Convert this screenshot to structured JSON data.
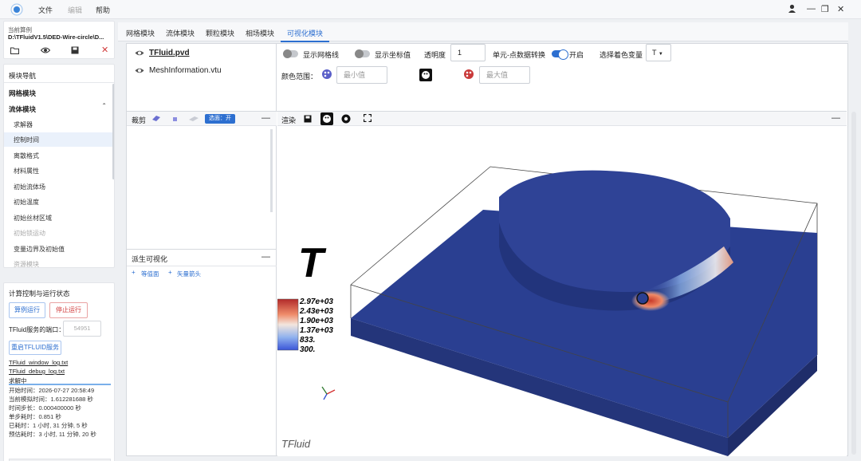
{
  "menu": {
    "file": "文件",
    "edit": "编辑",
    "help": "帮助"
  },
  "case": {
    "label": "当前算例",
    "path": "D:\\TFluidV1.5\\DED-Wire-circle\\D..."
  },
  "nav": {
    "title": "模块导航",
    "grid_module": "网格模块",
    "flow_module": "流体模块",
    "items": [
      "求解器",
      "控制时间",
      "离散格式",
      "材料属性",
      "初始流体场",
      "初始温度",
      "初始丝材区域",
      "初始锁运动",
      "变量边界及初始值",
      "资源模块"
    ]
  },
  "run": {
    "title": "计算控制与运行状态",
    "run_label": "算例运行",
    "stop_label": "停止运行",
    "port_label": "TFluid服务的端口：",
    "port_value": "54951",
    "restart_label": "重启TFLUID服务",
    "log1": "TFluid_window_log.txt",
    "log2": "TFluid_debug_log.txt",
    "status": "求解中",
    "lines": [
      "开始时间：2026-07-27 20:58:49",
      "当前模拟时间：1.612281688 秒",
      "时间步长：0.000400000 秒",
      "单步耗时：0.851 秒",
      "已耗时：1 小时, 31 分钟, 5 秒",
      "预估耗时：3 小时, 11 分钟, 20 秒"
    ]
  },
  "tabs": [
    "网格模块",
    "流体模块",
    "颗粒模块",
    "相场模块",
    "可视化模块"
  ],
  "files": [
    "TFluid.pvd",
    "MeshInformation.vtu"
  ],
  "viz": {
    "show_grid": "显示网格线",
    "show_coords": "显示坐标值",
    "opacity_label": "透明度",
    "opacity_value": "1",
    "cell_point_label": "单元-点数据转换",
    "on_label": "开启",
    "color_var_label": "选择着色变量",
    "color_var_value": "T",
    "range_label": "颜色范围：",
    "min_placeholder": "最小值",
    "max_placeholder": "最大值"
  },
  "clip": {
    "title": "裁剪",
    "tag": "选面：开"
  },
  "derived": {
    "title": "派生可视化",
    "contour": "等值面",
    "vector": "矢量箭头"
  },
  "render": {
    "title": "渲染"
  },
  "colorbar": {
    "var": "T",
    "ticks": [
      "2.97e+03",
      "2.43e+03",
      "1.90e+03",
      "1.37e+03",
      "833.",
      "300."
    ]
  },
  "brand": "TFluid",
  "colors": {
    "accent": "#2d6fd0",
    "stop": "#d13c3c",
    "substrate": "#2a3f91"
  }
}
